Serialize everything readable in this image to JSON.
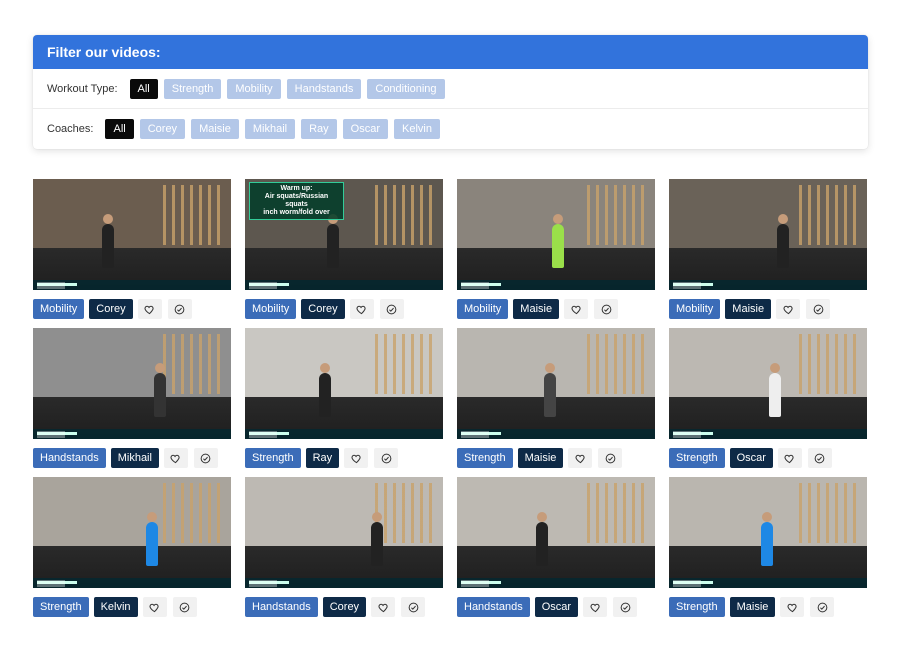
{
  "filter": {
    "title": "Filter our videos:",
    "workout_label": "Workout Type:",
    "workout_options": [
      "All",
      "Strength",
      "Mobility",
      "Handstands",
      "Conditioning"
    ],
    "workout_selected": "All",
    "coach_label": "Coaches:",
    "coach_options": [
      "All",
      "Corey",
      "Maisie",
      "Mikhail",
      "Ray",
      "Oscar",
      "Kelvin"
    ],
    "coach_selected": "All"
  },
  "colors": {
    "header": "#3273dc",
    "chip_active": "#0a0a0a",
    "chip_inactive": "#b3c7e8",
    "type_tag": "#3b6cb8",
    "coach_tag": "#0e2a47"
  },
  "videos": [
    {
      "type": "Mobility",
      "coach": "Corey",
      "overlay_text": ""
    },
    {
      "type": "Mobility",
      "coach": "Corey",
      "overlay_text": "Warm up:\nAir squats/Russian squats\ninch worm/fold over"
    },
    {
      "type": "Mobility",
      "coach": "Maisie",
      "overlay_text": ""
    },
    {
      "type": "Mobility",
      "coach": "Maisie",
      "overlay_text": ""
    },
    {
      "type": "Handstands",
      "coach": "Mikhail",
      "overlay_text": ""
    },
    {
      "type": "Strength",
      "coach": "Ray",
      "overlay_text": ""
    },
    {
      "type": "Strength",
      "coach": "Maisie",
      "overlay_text": ""
    },
    {
      "type": "Strength",
      "coach": "Oscar",
      "overlay_text": ""
    },
    {
      "type": "Strength",
      "coach": "Kelvin",
      "overlay_text": ""
    },
    {
      "type": "Handstands",
      "coach": "Corey",
      "overlay_text": ""
    },
    {
      "type": "Handstands",
      "coach": "Oscar",
      "overlay_text": ""
    },
    {
      "type": "Strength",
      "coach": "Maisie",
      "overlay_text": ""
    }
  ],
  "icons": {
    "favorite": "heart-icon",
    "complete": "check-circle-icon"
  }
}
